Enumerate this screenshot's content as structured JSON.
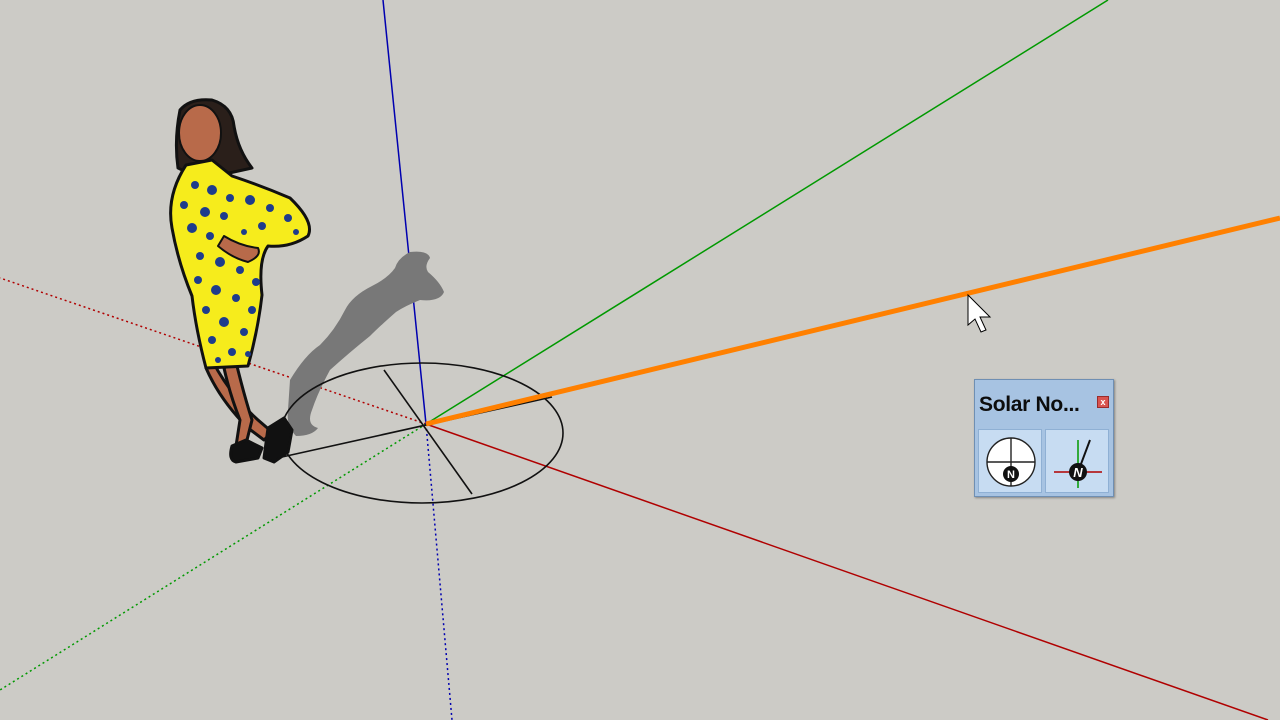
{
  "toolbar": {
    "title": "Solar No...",
    "close_label": "x",
    "buttons": [
      {
        "icon": "toggle-north-arrow-icon",
        "glyph": "N"
      },
      {
        "icon": "set-north-tool-icon",
        "glyph": "N"
      }
    ]
  },
  "colors": {
    "background": "#cccbc6",
    "red_axis": "#b00000",
    "green_axis": "#009900",
    "blue_axis": "#0000b0",
    "north_line": "#ff8000"
  }
}
